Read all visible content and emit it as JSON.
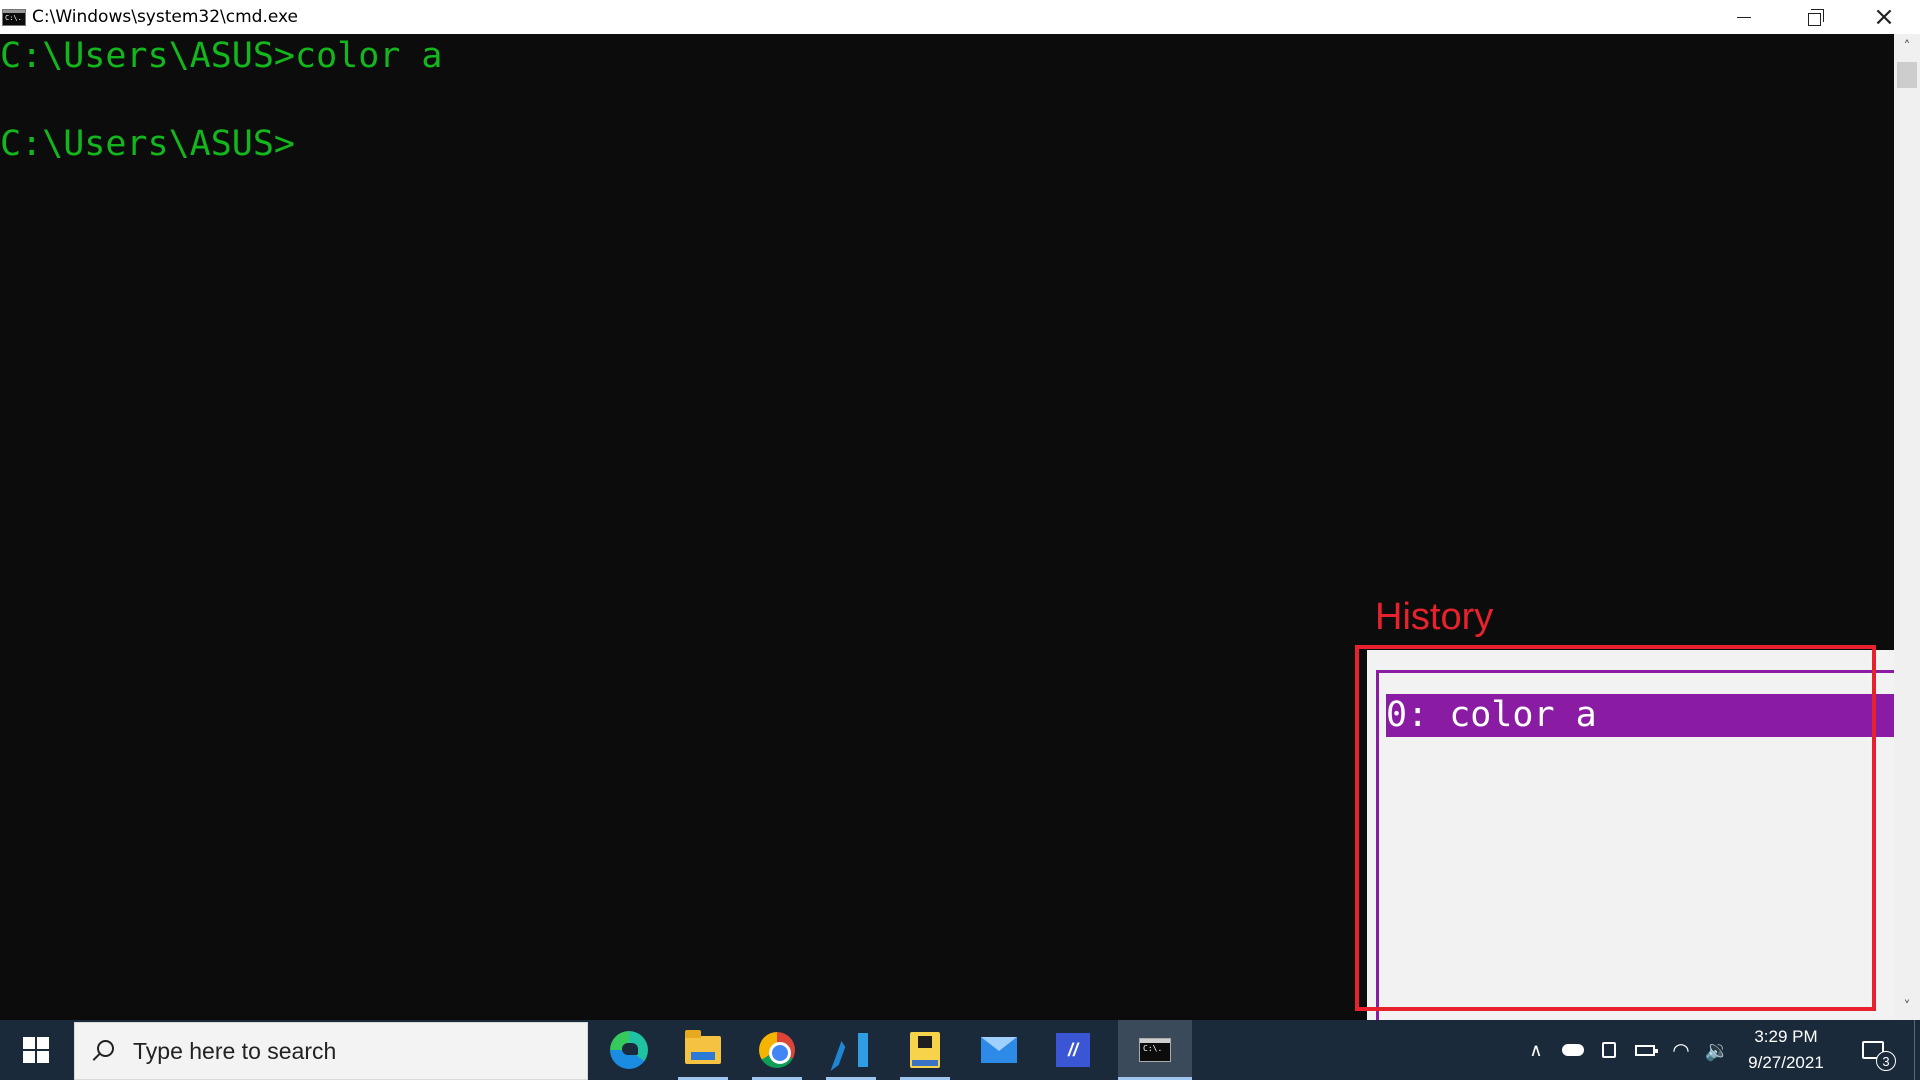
{
  "window": {
    "title": "C:\\Windows\\system32\\cmd.exe",
    "icon": "cmd-app-icon",
    "icon_text": "C:\\."
  },
  "console": {
    "lines": [
      "C:\\Users\\ASUS>color a",
      "C:\\Users\\ASUS>"
    ],
    "text_color": "#13b71d",
    "background": "#0c0c0c"
  },
  "history": {
    "label": "History",
    "label_color": "#e8222c",
    "items": [
      "0: color a"
    ],
    "selected_color": "#8a1ca4"
  },
  "taskbar": {
    "search_placeholder": "Type here to search",
    "apps": [
      {
        "name": "edge",
        "icon": "edge-icon"
      },
      {
        "name": "file-explorer",
        "icon": "folder-icon"
      },
      {
        "name": "chrome",
        "icon": "chrome-icon"
      },
      {
        "name": "vscode",
        "icon": "vscode-icon"
      },
      {
        "name": "python",
        "icon": "python-icon"
      },
      {
        "name": "mail",
        "icon": "mail-icon"
      },
      {
        "name": "stylus-app",
        "icon": "stylus-icon",
        "glyph": "//"
      },
      {
        "name": "cmd",
        "icon": "cmd-icon",
        "active": true
      }
    ],
    "clock": {
      "time": "3:29 PM",
      "date": "9/27/2021"
    },
    "notifications_count": "3"
  }
}
